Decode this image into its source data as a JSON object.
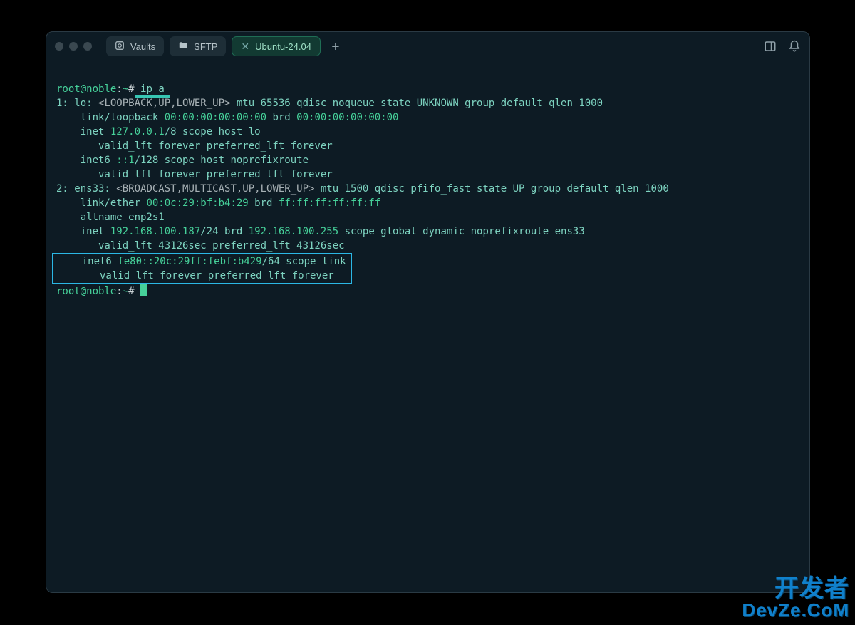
{
  "tabs": {
    "vaults": "Vaults",
    "sftp": "SFTP",
    "active": "Ubuntu-24.04"
  },
  "prompt": {
    "userhost": "root@noble",
    "sep": ":",
    "path": "~",
    "hash": "#",
    "cmd": "ip a"
  },
  "out": {
    "l1_a": "1: lo: ",
    "l1_b": "<LOOPBACK,UP,LOWER_UP>",
    "l1_c": " mtu 65536 qdisc noqueue state UNKNOWN group default qlen 1000",
    "l2_a": "    link/loopback ",
    "l2_b": "00:00:00:00:00:00",
    "l2_c": " brd ",
    "l2_d": "00:00:00:00:00:00",
    "l3_a": "    inet ",
    "l3_b": "127.0.0.1",
    "l3_c": "/8 scope host lo",
    "l4": "       valid_lft forever preferred_lft forever",
    "l5_a": "    inet6 ",
    "l5_b": "::1",
    "l5_c": "/128 scope host noprefixroute",
    "l6": "       valid_lft forever preferred_lft forever",
    "l7_a": "2: ens33: ",
    "l7_b": "<BROADCAST,MULTICAST,UP,LOWER_UP>",
    "l7_c": " mtu 1500 qdisc pfifo_fast state UP group default qlen 1000",
    "l8_a": "    link/ether ",
    "l8_b": "00:0c:29:bf:b4:29",
    "l8_c": " brd ",
    "l8_d": "ff:ff:ff:ff:ff:ff",
    "l9": "    altname enp2s1",
    "l10_a": "    inet ",
    "l10_b": "192.168.100.187",
    "l10_c": "/24 brd ",
    "l10_d": "192.168.100.255",
    "l10_e": " scope global dynamic noprefixroute ens33",
    "l11": "       valid_lft 43126sec preferred_lft 43126sec",
    "l12_a": "    inet6 ",
    "l12_b": "fe80::20c:29ff:febf:b429",
    "l12_c": "/64 scope link",
    "l13": "       valid_lft forever preferred_lft forever"
  },
  "watermark": {
    "line1": "开发者",
    "line2": "DevZe.CoM"
  },
  "colors": {
    "bg": "#0d1b24",
    "green": "#46d19a",
    "teal": "#7dd3c0",
    "box_border": "#2bb7e5",
    "cmd_underline": "#37c6b3"
  }
}
